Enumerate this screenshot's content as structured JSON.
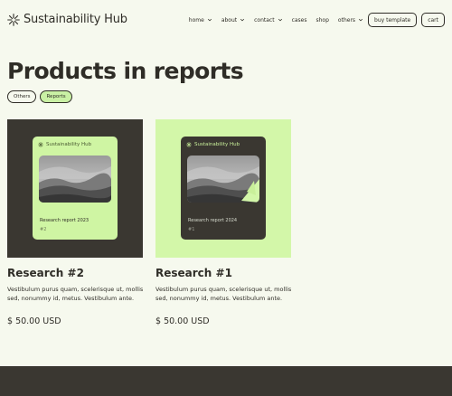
{
  "brand": {
    "name": "Sustainability Hub"
  },
  "nav": {
    "items": [
      {
        "label": "home",
        "has_dropdown": true
      },
      {
        "label": "about",
        "has_dropdown": true
      },
      {
        "label": "contact",
        "has_dropdown": true
      },
      {
        "label": "cases",
        "has_dropdown": false
      },
      {
        "label": "shop",
        "has_dropdown": false
      },
      {
        "label": "others",
        "has_dropdown": true
      }
    ],
    "buy_label": "buy template",
    "cart_label": "cart"
  },
  "page": {
    "title": "Products in reports"
  },
  "filters": [
    {
      "label": "Others",
      "active": false
    },
    {
      "label": "Reports",
      "active": true
    }
  ],
  "products": [
    {
      "title": "Research #2",
      "description": "Vestibulum purus quam, scelerisque ut, mollis sed, nonummy id, metus. Vestibulum ante.",
      "price": "$ 50.00 USD",
      "cover": {
        "brand": "Sustainability Hub",
        "report": "Research report 2023",
        "number": "#2"
      }
    },
    {
      "title": "Research #1",
      "description": "Vestibulum purus quam, scelerisque ut, mollis sed, nonummy id, metus. Vestibulum ante.",
      "price": "$ 50.00 USD",
      "cover": {
        "brand": "Sustainability Hub",
        "report": "Research report 2024",
        "number": "#1"
      }
    }
  ],
  "colors": {
    "background": "#f6f9ee",
    "dark": "#3a3731",
    "accent_green": "#cff5a3",
    "text": "#2f2d27"
  },
  "icons": [
    "sustainability-star-icon",
    "chevron-down-icon"
  ]
}
